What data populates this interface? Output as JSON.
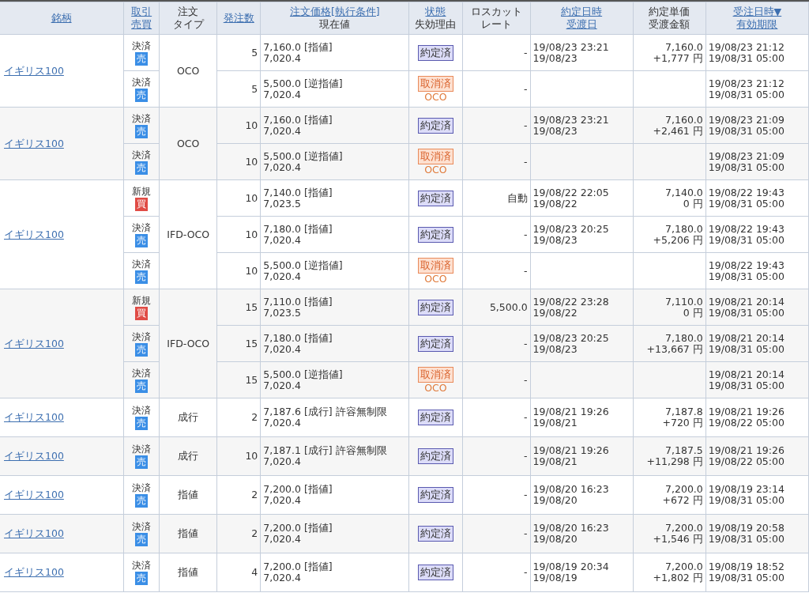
{
  "table": {
    "columns": [
      {
        "lines": [
          {
            "text": "銘柄",
            "link": true
          }
        ]
      },
      {
        "lines": [
          {
            "text": "取引",
            "link": true
          },
          {
            "text": "売買",
            "link": true
          }
        ]
      },
      {
        "lines": [
          {
            "text": "注文",
            "link": false
          },
          {
            "text": "タイプ",
            "link": false
          }
        ]
      },
      {
        "lines": [
          {
            "text": "発注数",
            "link": true
          }
        ]
      },
      {
        "lines": [
          {
            "text": "注文価格[執行条件]",
            "link": true
          },
          {
            "text": "現在値",
            "link": false
          }
        ]
      },
      {
        "lines": [
          {
            "text": "状態",
            "link": true
          },
          {
            "text": "失効理由",
            "link": false
          }
        ]
      },
      {
        "lines": [
          {
            "text": "ロスカット",
            "link": false
          },
          {
            "text": "レート",
            "link": false
          }
        ]
      },
      {
        "lines": [
          {
            "text": "約定日時",
            "link": true
          },
          {
            "text": "受渡日",
            "link": true
          }
        ]
      },
      {
        "lines": [
          {
            "text": "約定単価",
            "link": false
          },
          {
            "text": "受渡金額",
            "link": false
          }
        ]
      },
      {
        "lines": [
          {
            "text": "受注日時▼",
            "link": true
          },
          {
            "text": "有効期限",
            "link": true
          }
        ]
      }
    ],
    "groups": [
      {
        "symbol": "イギリス100",
        "order_type": "OCO",
        "legs": [
          {
            "trade": "決済",
            "side": {
              "text": "売",
              "kind": "sell"
            },
            "qty": "5",
            "price": "7,160.0 [指値]",
            "current": "7,020.4",
            "status": {
              "text": "約定済",
              "kind": "filled"
            },
            "losscut": "-",
            "exec_time": "19/08/23 23:21",
            "delivery": "19/08/23",
            "exec_price": "7,160.0",
            "amount": "+1,777 円",
            "order_time": "19/08/23 21:12",
            "expiry": "19/08/31 05:00"
          },
          {
            "trade": "決済",
            "side": {
              "text": "売",
              "kind": "sell"
            },
            "qty": "5",
            "price": "5,500.0 [逆指値]",
            "current": "7,020.4",
            "status": {
              "text": "取消済",
              "kind": "cancelled"
            },
            "reason": "OCO",
            "losscut": "-",
            "order_time": "19/08/23 21:12",
            "expiry": "19/08/31 05:00"
          }
        ]
      },
      {
        "symbol": "イギリス100",
        "order_type": "OCO",
        "legs": [
          {
            "trade": "決済",
            "side": {
              "text": "売",
              "kind": "sell"
            },
            "qty": "10",
            "price": "7,160.0 [指値]",
            "current": "7,020.4",
            "status": {
              "text": "約定済",
              "kind": "filled"
            },
            "losscut": "-",
            "exec_time": "19/08/23 23:21",
            "delivery": "19/08/23",
            "exec_price": "7,160.0",
            "amount": "+2,461 円",
            "order_time": "19/08/23 21:09",
            "expiry": "19/08/31 05:00"
          },
          {
            "trade": "決済",
            "side": {
              "text": "売",
              "kind": "sell"
            },
            "qty": "10",
            "price": "5,500.0 [逆指値]",
            "current": "7,020.4",
            "status": {
              "text": "取消済",
              "kind": "cancelled"
            },
            "reason": "OCO",
            "losscut": "-",
            "order_time": "19/08/23 21:09",
            "expiry": "19/08/31 05:00"
          }
        ]
      },
      {
        "symbol": "イギリス100",
        "order_type": "IFD-OCO",
        "legs": [
          {
            "trade": "新規",
            "side": {
              "text": "買",
              "kind": "buy"
            },
            "qty": "10",
            "price": "7,140.0 [指値]",
            "current": "7,023.5",
            "status": {
              "text": "約定済",
              "kind": "filled"
            },
            "losscut": "自動",
            "exec_time": "19/08/22 22:05",
            "delivery": "19/08/22",
            "exec_price": "7,140.0",
            "amount": "0 円",
            "order_time": "19/08/22 19:43",
            "expiry": "19/08/31 05:00"
          },
          {
            "trade": "決済",
            "side": {
              "text": "売",
              "kind": "sell"
            },
            "qty": "10",
            "price": "7,180.0 [指値]",
            "current": "7,020.4",
            "status": {
              "text": "約定済",
              "kind": "filled"
            },
            "losscut": "-",
            "exec_time": "19/08/23 20:25",
            "delivery": "19/08/23",
            "exec_price": "7,180.0",
            "amount": "+5,206 円",
            "order_time": "19/08/22 19:43",
            "expiry": "19/08/31 05:00"
          },
          {
            "trade": "決済",
            "side": {
              "text": "売",
              "kind": "sell"
            },
            "qty": "10",
            "price": "5,500.0 [逆指値]",
            "current": "7,020.4",
            "status": {
              "text": "取消済",
              "kind": "cancelled"
            },
            "reason": "OCO",
            "losscut": "-",
            "order_time": "19/08/22 19:43",
            "expiry": "19/08/31 05:00"
          }
        ]
      },
      {
        "symbol": "イギリス100",
        "order_type": "IFD-OCO",
        "legs": [
          {
            "trade": "新規",
            "side": {
              "text": "買",
              "kind": "buy"
            },
            "qty": "15",
            "price": "7,110.0 [指値]",
            "current": "7,023.5",
            "status": {
              "text": "約定済",
              "kind": "filled"
            },
            "losscut": "5,500.0",
            "exec_time": "19/08/22 23:28",
            "delivery": "19/08/22",
            "exec_price": "7,110.0",
            "amount": "0 円",
            "order_time": "19/08/21 20:14",
            "expiry": "19/08/31 05:00"
          },
          {
            "trade": "決済",
            "side": {
              "text": "売",
              "kind": "sell"
            },
            "qty": "15",
            "price": "7,180.0 [指値]",
            "current": "7,020.4",
            "status": {
              "text": "約定済",
              "kind": "filled"
            },
            "losscut": "-",
            "exec_time": "19/08/23 20:25",
            "delivery": "19/08/23",
            "exec_price": "7,180.0",
            "amount": "+13,667 円",
            "order_time": "19/08/21 20:14",
            "expiry": "19/08/31 05:00"
          },
          {
            "trade": "決済",
            "side": {
              "text": "売",
              "kind": "sell"
            },
            "qty": "15",
            "price": "5,500.0 [逆指値]",
            "current": "7,020.4",
            "status": {
              "text": "取消済",
              "kind": "cancelled"
            },
            "reason": "OCO",
            "losscut": "-",
            "order_time": "19/08/21 20:14",
            "expiry": "19/08/31 05:00"
          }
        ]
      },
      {
        "symbol": "イギリス100",
        "order_type": "成行",
        "legs": [
          {
            "trade": "決済",
            "side": {
              "text": "売",
              "kind": "sell"
            },
            "qty": "2",
            "price": "7,187.6 [成行] 許容無制限",
            "current": "7,020.4",
            "status": {
              "text": "約定済",
              "kind": "filled"
            },
            "losscut": "-",
            "exec_time": "19/08/21 19:26",
            "delivery": "19/08/21",
            "exec_price": "7,187.8",
            "amount": "+720 円",
            "order_time": "19/08/21 19:26",
            "expiry": "19/08/22 05:00"
          }
        ]
      },
      {
        "symbol": "イギリス100",
        "order_type": "成行",
        "legs": [
          {
            "trade": "決済",
            "side": {
              "text": "売",
              "kind": "sell"
            },
            "qty": "10",
            "price": "7,187.1 [成行] 許容無制限",
            "current": "7,020.4",
            "status": {
              "text": "約定済",
              "kind": "filled"
            },
            "losscut": "-",
            "exec_time": "19/08/21 19:26",
            "delivery": "19/08/21",
            "exec_price": "7,187.5",
            "amount": "+11,298 円",
            "order_time": "19/08/21 19:26",
            "expiry": "19/08/22 05:00"
          }
        ]
      },
      {
        "symbol": "イギリス100",
        "order_type": "指値",
        "legs": [
          {
            "trade": "決済",
            "side": {
              "text": "売",
              "kind": "sell"
            },
            "qty": "2",
            "price": "7,200.0 [指値]",
            "current": "7,020.4",
            "status": {
              "text": "約定済",
              "kind": "filled"
            },
            "losscut": "-",
            "exec_time": "19/08/20 16:23",
            "delivery": "19/08/20",
            "exec_price": "7,200.0",
            "amount": "+672 円",
            "order_time": "19/08/19 23:14",
            "expiry": "19/08/31 05:00"
          }
        ]
      },
      {
        "symbol": "イギリス100",
        "order_type": "指値",
        "legs": [
          {
            "trade": "決済",
            "side": {
              "text": "売",
              "kind": "sell"
            },
            "qty": "2",
            "price": "7,200.0 [指値]",
            "current": "7,020.4",
            "status": {
              "text": "約定済",
              "kind": "filled"
            },
            "losscut": "-",
            "exec_time": "19/08/20 16:23",
            "delivery": "19/08/20",
            "exec_price": "7,200.0",
            "amount": "+1,546 円",
            "order_time": "19/08/19 20:58",
            "expiry": "19/08/31 05:00"
          }
        ]
      },
      {
        "symbol": "イギリス100",
        "order_type": "指値",
        "legs": [
          {
            "trade": "決済",
            "side": {
              "text": "売",
              "kind": "sell"
            },
            "qty": "4",
            "price": "7,200.0 [指値]",
            "current": "7,020.4",
            "status": {
              "text": "約定済",
              "kind": "filled"
            },
            "losscut": "-",
            "exec_time": "19/08/19 20:34",
            "delivery": "19/08/19",
            "exec_price": "7,200.0",
            "amount": "+1,802 円",
            "order_time": "19/08/19 18:52",
            "expiry": "19/08/31 05:00"
          }
        ]
      }
    ]
  }
}
